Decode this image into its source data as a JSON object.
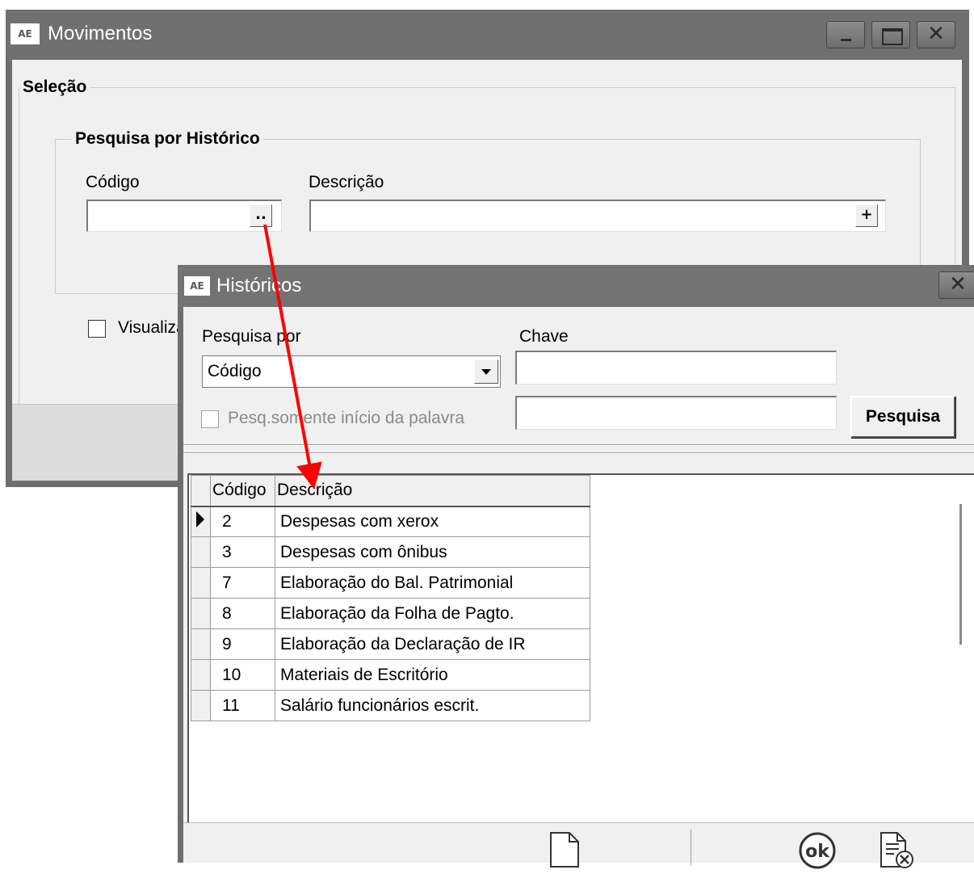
{
  "movimentos": {
    "icon_text": "AE",
    "title": "Movimentos",
    "selecao_legend": "Seleção",
    "pesquisa_legend": "Pesquisa por Histórico",
    "codigo_label": "Código",
    "codigo_button": "..",
    "descricao_label": "Descrição",
    "descricao_button": "+",
    "visualizar_label": "Visualiza"
  },
  "historicos": {
    "icon_text": "AE",
    "title": "Históricos",
    "close_glyph": "✕",
    "pesquisa_por_label": "Pesquisa por",
    "pesquisa_por_value": "Código",
    "chave_label": "Chave",
    "somente_inicio_label": "Pesq.somente início da palavra",
    "pesquisa_button": "Pesquisa",
    "grid": {
      "columns": [
        "Código",
        "Descrição"
      ],
      "rows": [
        {
          "codigo": "2",
          "descricao": "Despesas com xerox"
        },
        {
          "codigo": "3",
          "descricao": "Despesas com ônibus"
        },
        {
          "codigo": "7",
          "descricao": "Elaboração do Bal. Patrimonial"
        },
        {
          "codigo": "8",
          "descricao": "Elaboração da Folha de Pagto."
        },
        {
          "codigo": "9",
          "descricao": "Elaboração da Declaração de IR"
        },
        {
          "codigo": "10",
          "descricao": "Materiais de Escritório"
        },
        {
          "codigo": "11",
          "descricao": "Salário funcionários escrit."
        }
      ]
    },
    "toolbar": {
      "new_icon": "new-document-icon",
      "ok_label": "ok",
      "cancel_icon": "cancel-document-icon"
    }
  },
  "annotation": {
    "arrow_color": "#ff0000"
  }
}
